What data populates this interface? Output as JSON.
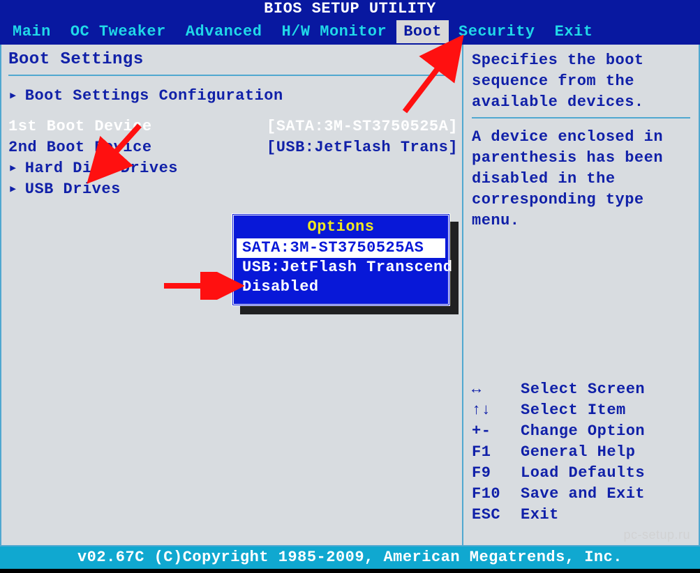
{
  "title": "BIOS SETUP UTILITY",
  "tabs": {
    "items": [
      {
        "label": "Main"
      },
      {
        "label": "OC Tweaker"
      },
      {
        "label": "Advanced"
      },
      {
        "label": "H/W Monitor"
      },
      {
        "label": "Boot",
        "selected": true
      },
      {
        "label": "Security"
      },
      {
        "label": "Exit"
      }
    ]
  },
  "main": {
    "section_title": "Boot Settings",
    "items": [
      {
        "label": "Boot Settings Configuration",
        "submenu": true
      },
      {
        "spacer": true
      },
      {
        "label": "1st Boot Device",
        "value": "[SATA:3M-ST3750525A]",
        "selected": true
      },
      {
        "label": "2nd Boot Device",
        "value": "[USB:JetFlash Trans]"
      },
      {
        "label": "Hard Disk Drives",
        "submenu": true
      },
      {
        "label": "USB Drives",
        "submenu": true
      }
    ]
  },
  "popup": {
    "title": "Options",
    "items": [
      {
        "label": "SATA:3M-ST3750525AS",
        "selected": true
      },
      {
        "label": "USB:JetFlash Transcend"
      },
      {
        "label": "Disabled"
      }
    ]
  },
  "help": {
    "para1": "Specifies the boot sequence from the available devices.",
    "para2": "A device enclosed in parenthesis has been disabled in the corresponding type menu."
  },
  "keys": [
    {
      "key": "↔",
      "desc": "Select Screen"
    },
    {
      "key": "↑↓",
      "desc": "Select Item"
    },
    {
      "key": "+-",
      "desc": "Change Option"
    },
    {
      "key": "F1",
      "desc": "General Help"
    },
    {
      "key": "F9",
      "desc": "Load Defaults"
    },
    {
      "key": "F10",
      "desc": "Save and Exit"
    },
    {
      "key": "ESC",
      "desc": "Exit"
    }
  ],
  "footer": "v02.67C (C)Copyright 1985-2009, American Megatrends, Inc.",
  "watermark": "pc-setup.ru"
}
